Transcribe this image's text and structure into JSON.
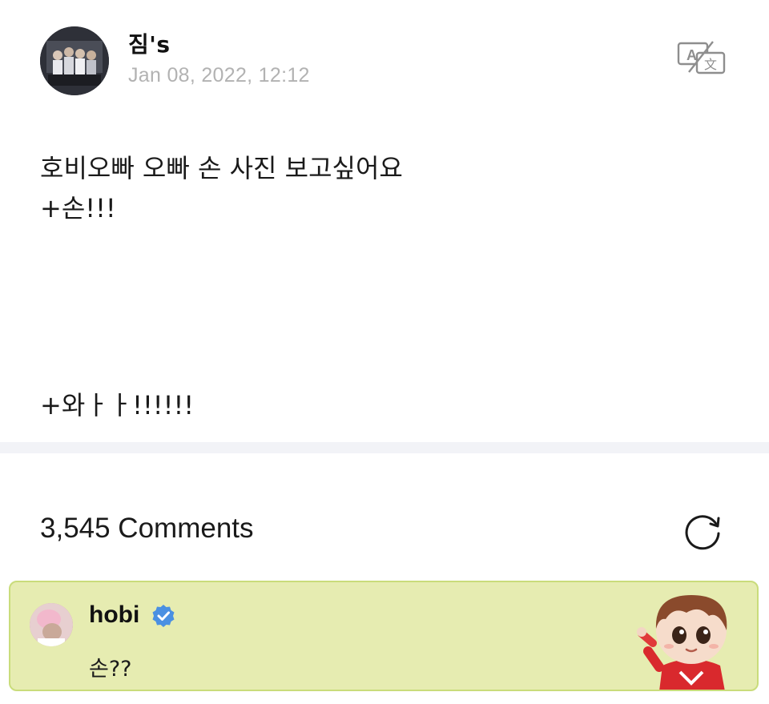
{
  "post": {
    "author": "짐's",
    "timestamp": "Jan 08, 2022, 12:12",
    "translate_icon": "translate-icon",
    "body_lines": [
      "호비오빠 오빠 손 사진 보고싶어요",
      "+손!!!",
      "+와ㅏㅏ!!!!!!"
    ]
  },
  "comments": {
    "count_label": "3,545 Comments",
    "refresh_icon": "refresh-icon",
    "highlighted": {
      "author": "hobi",
      "verified": true,
      "text": "손??",
      "background_color": "#e6ecb1",
      "border_color": "#c9dc7b",
      "verified_color": "#4a90e2"
    }
  }
}
